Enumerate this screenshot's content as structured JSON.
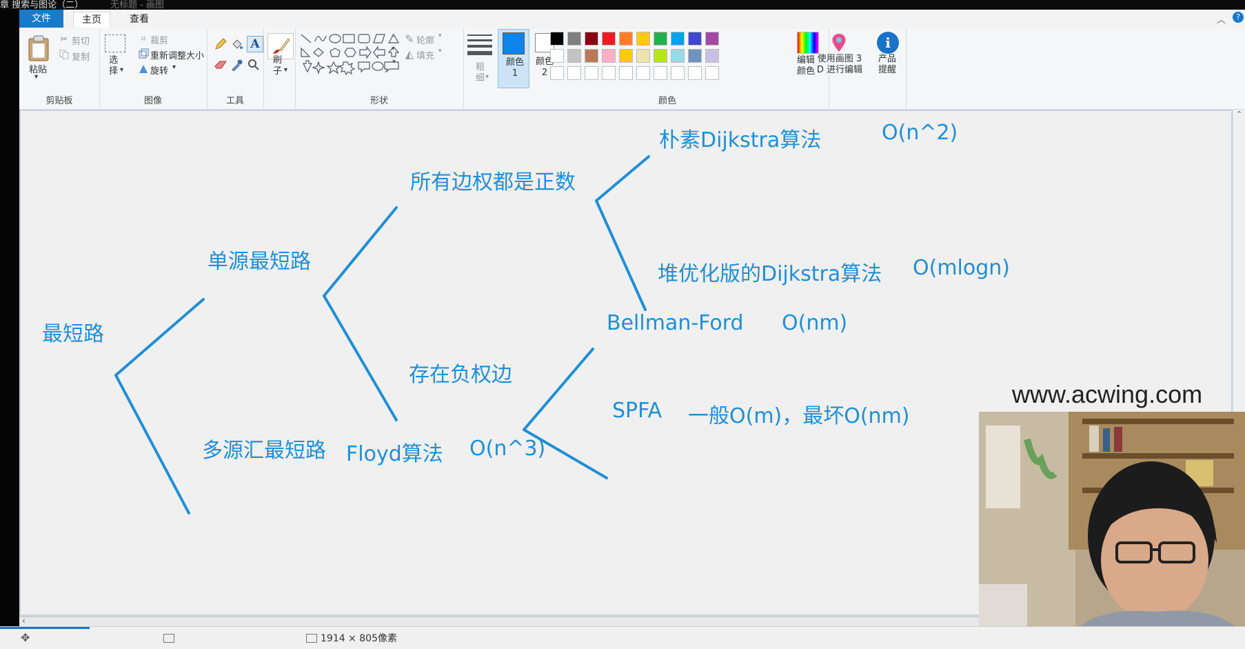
{
  "window": {
    "title": "章 搜索与图论（二）",
    "document_title": "无标题 - 画图"
  },
  "ribbon": {
    "tabs": [
      {
        "label": "文件"
      },
      {
        "label": "主页"
      },
      {
        "label": "查看"
      }
    ],
    "clipboard": {
      "paste": "粘贴",
      "cut": "剪切",
      "copy": "复制",
      "group": "剪贴板"
    },
    "image": {
      "select": "选择",
      "crop": "裁剪",
      "resize": "重新调整大小",
      "rotate": "旋转",
      "group": "图像"
    },
    "tools": {
      "group": "工具"
    },
    "brush": {
      "label": "刷子"
    },
    "shapes": {
      "outline": "轮廓",
      "fill": "填充",
      "group": "形状"
    },
    "size": {
      "label": "粗细"
    },
    "color1": {
      "label": "颜色 1"
    },
    "color2": {
      "label": "颜色 2"
    },
    "colors": {
      "group": "颜色",
      "edit": "编辑颜色"
    },
    "paint3d": {
      "label": "使用画图 3 D 进行编辑"
    },
    "product": {
      "label": "产品提醒"
    }
  },
  "palette": {
    "row1": [
      "#000000",
      "#7f7f7f",
      "#880015",
      "#ed1c24",
      "#ff7f27",
      "#ffc90e",
      "#22b14c",
      "#00a2e8",
      "#3f48cc",
      "#a349a4"
    ],
    "row2": [
      "#ffffff",
      "#c3c3c3",
      "#b97a57",
      "#ffaec9",
      "#ffc90e",
      "#efe4b0",
      "#b5e61d",
      "#99d9ea",
      "#7092be",
      "#c8bfe7"
    ],
    "row3": [
      "#ffffff",
      "#ffffff",
      "#ffffff",
      "#ffffff",
      "#ffffff",
      "#ffffff",
      "#ffffff",
      "#ffffff",
      "#ffffff",
      "#ffffff"
    ],
    "color1": "#0f84e8",
    "color2": "#ffffff",
    "accent": "#1f8fd6"
  },
  "diagram": {
    "root": "最短路",
    "single_source": "单源最短路",
    "all_positive": "所有边权都是正数",
    "naive_dijkstra": "朴素Dijkstra算法",
    "naive_complexity": "O(n^2)",
    "heap_dijkstra": "堆优化版的Dijkstra算法",
    "heap_complexity": "O(mlogn)",
    "negative_edge": "存在负权边",
    "bellman_ford": "Bellman-Ford",
    "bellman_complexity": "O(nm)",
    "spfa": "SPFA",
    "spfa_complexity": "一般O(m)，最坏O(nm)",
    "multi_source": "多源汇最短路",
    "floyd": "Floyd算法",
    "floyd_complexity": "O(n^3)"
  },
  "watermark": "www.acwing.com",
  "status": {
    "dimensions": "1914 × 805像素"
  }
}
